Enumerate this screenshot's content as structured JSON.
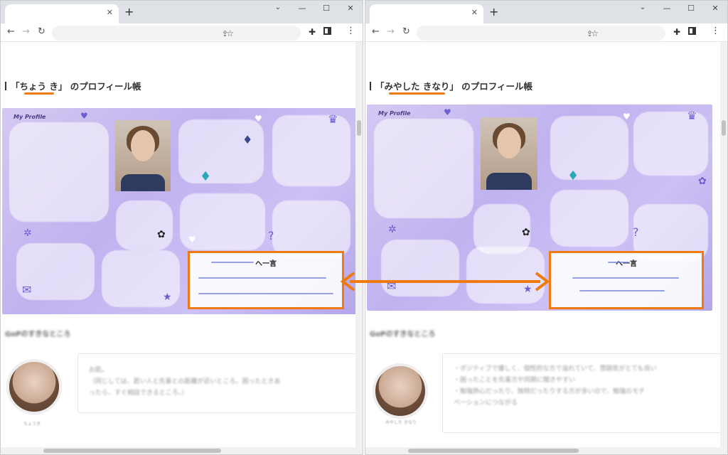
{
  "left": {
    "heading_open": "「",
    "heading_name": "ちょう き",
    "heading_close": "」",
    "heading_suffix": "のプロフィール帳",
    "card_title": "My Profile",
    "box_title": "ヘ一言",
    "section_title": "GoPのすきなところ",
    "avatar_caption": "ちょうき",
    "bubble_lines": [
      "お肌。",
      "（同じしては、若い人と先輩との距離が近いところ。困ったときあ",
      "ったら、すぐ相談できるところ。）"
    ]
  },
  "right": {
    "heading_open": "「",
    "heading_name": "みやした きなり",
    "heading_close": "」",
    "heading_suffix": "のプロフィール帳",
    "card_title": "My Profile",
    "box_title": "ヘ一言",
    "section_title": "GoPのすきなところ",
    "avatar_caption": "みやした きなり",
    "bubble_lines": [
      "・ポジティブで優しく、個性的な方で溢れていて、雰囲気がとても良い",
      "・困ったことを先輩方や同期に聞きやすい",
      "・勉強熱心だったり、独特だったりする方が多いので、勉強のモチ",
      "ベーションにつながる"
    ]
  },
  "colors": {
    "highlight": "#f07a12",
    "card": "#c0b2ef"
  },
  "icons": {
    "window": [
      "chevron-down-icon",
      "minimize-icon",
      "maximize-icon",
      "close-icon"
    ],
    "toolbar": [
      "back-icon",
      "forward-icon",
      "reload-icon",
      "share-icon",
      "star-icon",
      "extensions-icon",
      "side-panel-icon",
      "menu-icon"
    ]
  }
}
